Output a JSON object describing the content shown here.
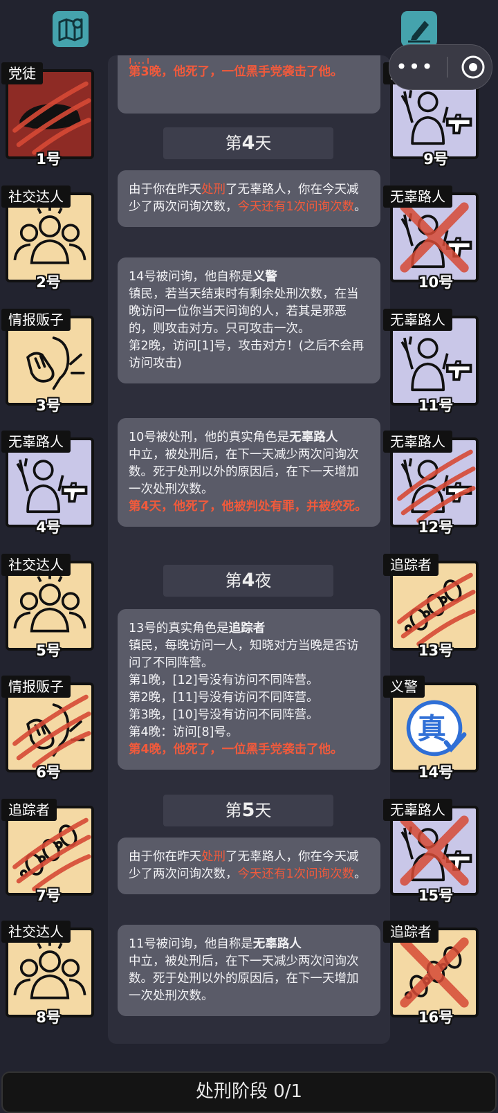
{
  "top": {
    "map_icon": "map-pin-icon",
    "notes_icon": "pen-icon",
    "more_icon": "ellipsis-icon",
    "close_icon": "target-circle-icon"
  },
  "players_left": [
    {
      "role": "党徒",
      "num": "1号",
      "icon": "car-icon",
      "bg": "#8e2b25",
      "dead": true,
      "mark": "claw"
    },
    {
      "role": "社交达人",
      "num": "2号",
      "icon": "crowd-icon",
      "bg": "#f4d9a4",
      "dead": false
    },
    {
      "role": "情报贩子",
      "num": "3号",
      "icon": "whisper-icon",
      "bg": "#f4d9a4",
      "dead": false
    },
    {
      "role": "无辜路人",
      "num": "4号",
      "icon": "hands-up-gun-icon",
      "bg": "#c9c7e8",
      "dead": false
    },
    {
      "role": "社交达人",
      "num": "5号",
      "icon": "crowd-icon",
      "bg": "#f4d9a4",
      "dead": false
    },
    {
      "role": "情报贩子",
      "num": "6号",
      "icon": "whisper-icon",
      "bg": "#f4d9a4",
      "dead": true,
      "mark": "claw"
    },
    {
      "role": "追踪者",
      "num": "7号",
      "icon": "footprints-icon",
      "bg": "#f4d9a4",
      "dead": true,
      "mark": "claw"
    },
    {
      "role": "社交达人",
      "num": "8号",
      "icon": "crowd-icon",
      "bg": "#f4d9a4",
      "dead": false
    }
  ],
  "players_right": [
    {
      "role": "无辜路人",
      "num": "9号",
      "icon": "hands-up-gun-icon",
      "bg": "#c9c7e8",
      "dead": false
    },
    {
      "role": "无辜路人",
      "num": "10号",
      "icon": "hands-up-gun-icon",
      "bg": "#c9c7e8",
      "dead": true,
      "mark": "x"
    },
    {
      "role": "无辜路人",
      "num": "11号",
      "icon": "hands-up-gun-icon",
      "bg": "#c9c7e8",
      "dead": false
    },
    {
      "role": "无辜路人",
      "num": "12号",
      "icon": "hands-up-gun-icon",
      "bg": "#c9c7e8",
      "dead": true,
      "mark": "claw"
    },
    {
      "role": "追踪者",
      "num": "13号",
      "icon": "footprints-icon",
      "bg": "#f4d9a4",
      "dead": true,
      "mark": "claw"
    },
    {
      "role": "义警",
      "num": "14号",
      "icon": "verified-badge-icon",
      "bg": "#f4d9a4",
      "dead": false
    },
    {
      "role": "无辜路人",
      "num": "15号",
      "icon": "hands-up-gun-icon",
      "bg": "#c9c7e8",
      "dead": true,
      "mark": "x"
    },
    {
      "role": "追踪者",
      "num": "16号",
      "icon": "footprints-icon",
      "bg": "#f4d9a4",
      "dead": true,
      "mark": "x"
    }
  ],
  "log": {
    "m0": {
      "top": "[...]",
      "red": "第3晚，他死了，一位黑手党袭击了他。"
    },
    "day4": {
      "prefix": "第",
      "num": "4",
      "suffix": "天"
    },
    "m1": {
      "a": "由于你在昨天",
      "b": "处刑",
      "c": "了无辜路人，你在今天减少了两次问询次数，",
      "d": "今天还有1次问询次数",
      "e": "。"
    },
    "m2": {
      "a": "14号被问询，他自称是",
      "b": "义警",
      "c": "镇民，若当天结束时有剩余处刑次数，在当晚访问一位你当天问询的人，若其是邪恶的，则攻击对方。只可攻击一次。",
      "d": "第2晚，访问[1]号，攻击对方！(之后不会再访问攻击)"
    },
    "m3": {
      "a": "10号被处刑，他的真实角色是",
      "b": "无辜路人",
      "c": "中立，被处刑后，在下一天减少两次问询次数。死于处刑以外的原因后，在下一天增加一次处刑次数。",
      "d": "第4天，他死了，他被判处有罪，并被绞死。"
    },
    "night4": {
      "prefix": "第",
      "num": "4",
      "suffix": "夜"
    },
    "m4": {
      "a": "13号的真实角色是",
      "b": "追踪者",
      "c": "镇民，每晚访问一人，知晓对方当晚是否访问了不同阵营。",
      "lines": [
        "第1晚，[12]号没有访问不同阵营。",
        "第2晚，[11]号没有访问不同阵营。",
        "第3晚，[10]号没有访问不同阵营。",
        "第4晚：访问[8]号。"
      ],
      "d": "第4晚，他死了，一位黑手党袭击了他。"
    },
    "day5": {
      "prefix": "第",
      "num": "5",
      "suffix": "天"
    },
    "m5": {
      "a": "由于你在昨天",
      "b": "处刑",
      "c": "了无辜路人，你在今天减少了两次问询次数，",
      "d": "今天还有1次问询次数",
      "e": "。"
    },
    "m6": {
      "a": "11号被问询，他自称是",
      "b": "无辜路人",
      "c": "中立，被处刑后，在下一天减少两次问询次数。死于处刑以外的原因后，在下一天增加一次处刑次数。"
    }
  },
  "bottom": {
    "label": "处刑阶段 0/1"
  }
}
